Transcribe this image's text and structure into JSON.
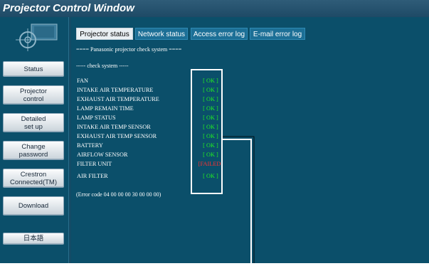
{
  "window": {
    "title": "Projector Control Window"
  },
  "sidebar": {
    "buttons": [
      {
        "label": "Status"
      },
      {
        "label": "Projector\ncontrol"
      },
      {
        "label": "Detailed\nset up"
      },
      {
        "label": "Change\npassword"
      },
      {
        "label": "Crestron\nConnected(TM)"
      },
      {
        "label": "Download"
      },
      {
        "label": "日本語"
      }
    ]
  },
  "tabs": [
    {
      "label": "Projector status",
      "active": true
    },
    {
      "label": "Network status",
      "active": false
    },
    {
      "label": "Access error log",
      "active": false
    },
    {
      "label": "E-mail error log",
      "active": false
    }
  ],
  "content": {
    "header": "==== Panasonic projector check system ====",
    "subheader": "----- check system -----",
    "items": [
      {
        "name": "FAN",
        "status": "[ OK ]"
      },
      {
        "name": "INTAKE AIR TEMPERATURE",
        "status": "[ OK ]"
      },
      {
        "name": "EXHAUST AIR TEMPERATURE",
        "status": "[ OK ]"
      },
      {
        "name": "LAMP REMAIN TIME",
        "status": "[ OK ]"
      },
      {
        "name": "LAMP STATUS",
        "status": "[ OK ]"
      },
      {
        "name": "INTAKE AIR TEMP SENSOR",
        "status": "[ OK ]"
      },
      {
        "name": "EXHAUST AIR TEMP SENSOR",
        "status": "[ OK ]"
      },
      {
        "name": "BATTERY",
        "status": "[ OK ]"
      },
      {
        "name": "AIRFLOW SENSOR",
        "status": "[ OK ]"
      },
      {
        "name": "FILTER UNIT",
        "status": "[FAILED]"
      },
      {
        "name": "AIR FILTER",
        "status": "[ OK ]"
      }
    ],
    "error_code": "(Error code 04 00 00 00 30 00 00 00)"
  },
  "colors": {
    "ok": "#22ee22",
    "failed": "#ff3030",
    "panel": "#0b4f6a",
    "tab": "#1c6f96"
  }
}
